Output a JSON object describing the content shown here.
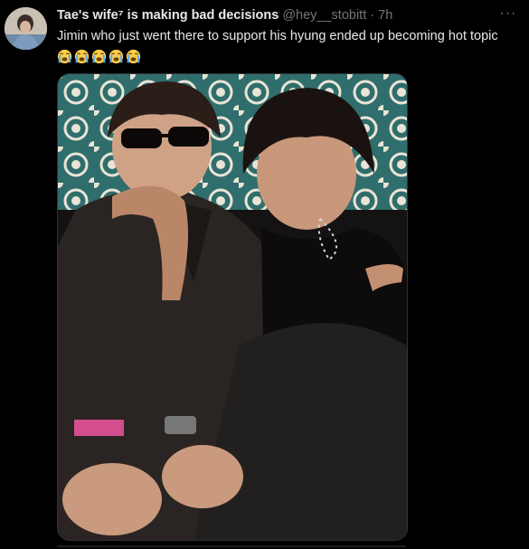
{
  "tweet": {
    "display_name": "Tae's wife⁷ is making bad decisions",
    "handle": "@hey__stobitt",
    "separator": "·",
    "time": "7h",
    "more_label": "···",
    "text": "Jimin who just went there to support his hyung ended up becoming hot topic",
    "emoji_count": 5,
    "emoji_name": "loudly-crying-face"
  },
  "colors": {
    "background": "#000000",
    "text_primary": "#e7e9ea",
    "text_secondary": "#71767b",
    "media_border": "#2f3336"
  }
}
